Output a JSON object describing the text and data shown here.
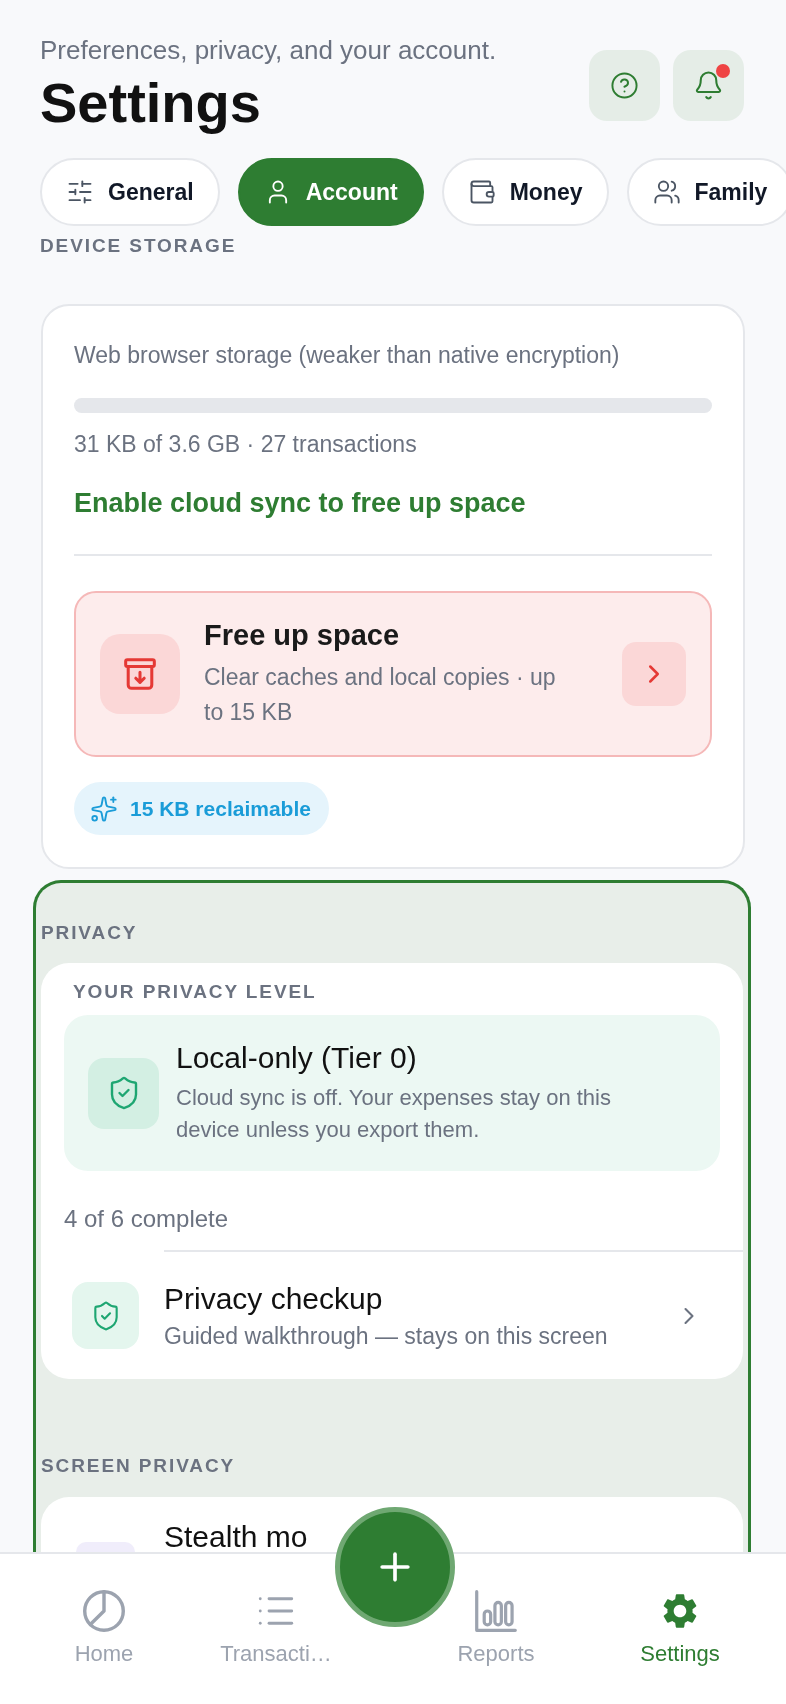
{
  "header": {
    "subtitle": "Preferences, privacy, and your account.",
    "title": "Settings",
    "has_unread_notifications": true
  },
  "tabs": [
    {
      "label": "General",
      "selected": false
    },
    {
      "label": "Account",
      "selected": true
    },
    {
      "label": "Money",
      "selected": false
    },
    {
      "label": "Family",
      "selected": false
    }
  ],
  "device_storage": {
    "heading": "DEVICE STORAGE",
    "storage_type": "Web browser storage (weaker than native encryption)",
    "level": 0,
    "usage": "31 KB of 3.6 GB · 27 transactions",
    "cloud_sync_link": "Enable cloud sync to free up space",
    "free_up_space": {
      "title": "Free up space",
      "description": "Clear caches and local copies · up to 15 KB"
    },
    "reclaimable": "15 KB reclaimable"
  },
  "privacy_group": {
    "highlighted": true,
    "privacy": {
      "heading": "PRIVACY",
      "level_card": {
        "label": "YOUR PRIVACY LEVEL",
        "title": "Local-only (Tier 0)",
        "description": "Cloud sync is off. Your expenses stay on this device unless you export them."
      },
      "progress": "4 of 6 complete",
      "rows": [
        {
          "title": "Privacy checkup",
          "subtitle": "Guided walkthrough — stays on this screen"
        }
      ]
    },
    "screen_privacy": {
      "heading": "SCREEN PRIVACY",
      "rows": [
        {
          "title": "Stealth mo"
        }
      ]
    }
  },
  "bottom_nav": [
    {
      "label": "Home",
      "selected": false
    },
    {
      "label": "Transacti…",
      "selected": false
    },
    {
      "label": "Reports",
      "selected": false
    },
    {
      "label": "Settings",
      "selected": true
    }
  ]
}
